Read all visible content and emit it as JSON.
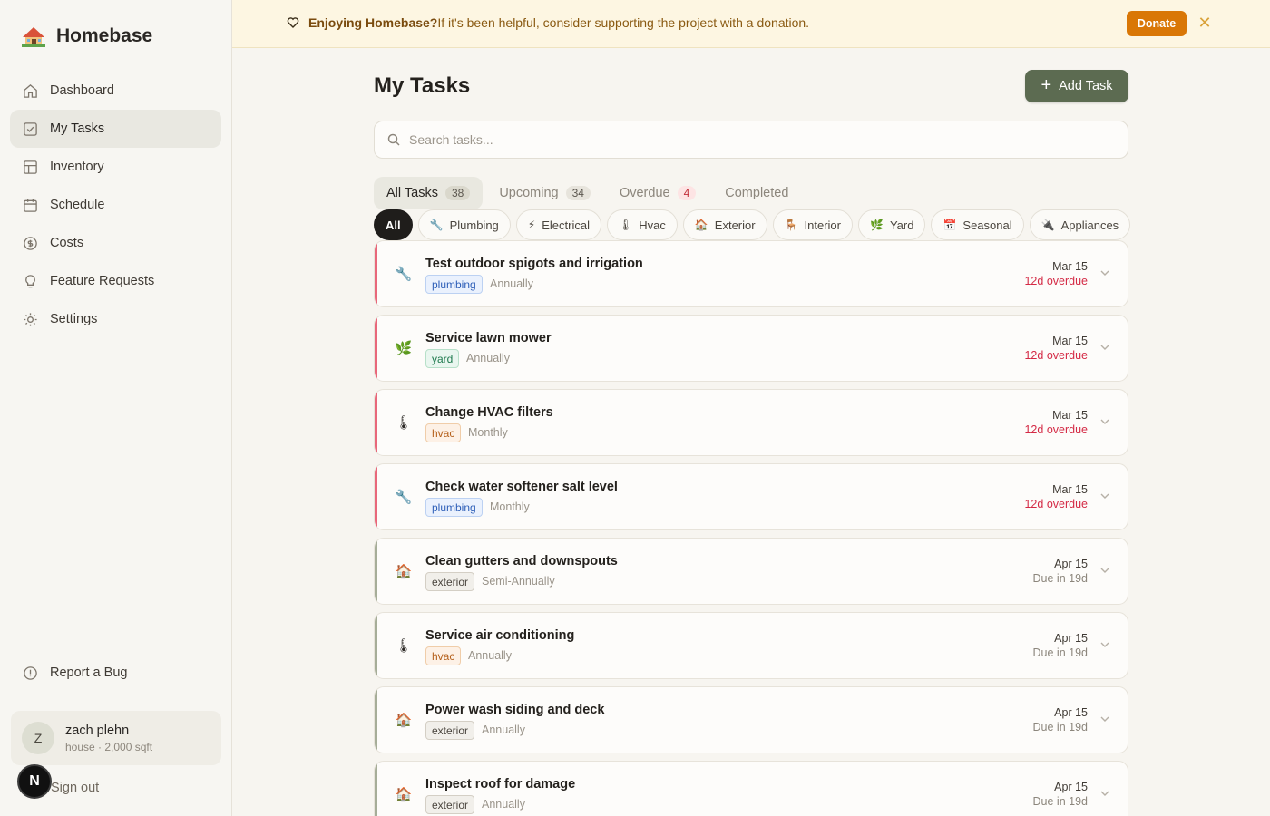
{
  "app": {
    "name": "Homebase",
    "logo_icon": "house-emoji-icon"
  },
  "sidebar": {
    "items": [
      {
        "label": "Dashboard",
        "icon": "home-icon"
      },
      {
        "label": "My Tasks",
        "icon": "checkbox-icon",
        "active": true
      },
      {
        "label": "Inventory",
        "icon": "layout-icon"
      },
      {
        "label": "Schedule",
        "icon": "calendar-icon"
      },
      {
        "label": "Costs",
        "icon": "coin-icon"
      },
      {
        "label": "Feature Requests",
        "icon": "lightbulb-icon"
      },
      {
        "label": "Settings",
        "icon": "sun-gear-icon"
      }
    ],
    "report_bug": "Report a Bug",
    "user": {
      "initial": "Z",
      "name": "zach plehn",
      "subtitle": "house · 2,000 sqft"
    },
    "sign_out": "Sign out",
    "next_badge": "N"
  },
  "banner": {
    "strong": "Enjoying Homebase?",
    "text": "If it's been helpful, consider supporting the project with a donation.",
    "donate_label": "Donate",
    "close_glyph": "✕"
  },
  "main": {
    "title": "My Tasks",
    "add_task_label": "Add Task",
    "search_placeholder": "Search tasks...",
    "tabs": [
      {
        "label": "All Tasks",
        "count": "38",
        "active": true
      },
      {
        "label": "Upcoming",
        "count": "34"
      },
      {
        "label": "Overdue",
        "count": "4",
        "alert": true
      },
      {
        "label": "Completed",
        "count": ""
      }
    ],
    "filters": [
      {
        "label": "All",
        "emoji": "",
        "active": true
      },
      {
        "label": "Plumbing",
        "emoji": "🔧"
      },
      {
        "label": "Electrical",
        "emoji": "⚡"
      },
      {
        "label": "Hvac",
        "emoji": "🌡"
      },
      {
        "label": "Exterior",
        "emoji": "🏠"
      },
      {
        "label": "Interior",
        "emoji": "🪑"
      },
      {
        "label": "Yard",
        "emoji": "🌿"
      },
      {
        "label": "Seasonal",
        "emoji": "📅"
      },
      {
        "label": "Appliances",
        "emoji": "🔌"
      }
    ],
    "tasks": [
      {
        "title": "Test outdoor spigots and irrigation",
        "tag": "plumbing",
        "frequency": "Annually",
        "date": "Mar 15",
        "status": "12d overdue",
        "overdue": true,
        "emoji": "🔧"
      },
      {
        "title": "Service lawn mower",
        "tag": "yard",
        "frequency": "Annually",
        "date": "Mar 15",
        "status": "12d overdue",
        "overdue": true,
        "emoji": "🌿"
      },
      {
        "title": "Change HVAC filters",
        "tag": "hvac",
        "frequency": "Monthly",
        "date": "Mar 15",
        "status": "12d overdue",
        "overdue": true,
        "emoji": "🌡"
      },
      {
        "title": "Check water softener salt level",
        "tag": "plumbing",
        "frequency": "Monthly",
        "date": "Mar 15",
        "status": "12d overdue",
        "overdue": true,
        "emoji": "🔧"
      },
      {
        "title": "Clean gutters and downspouts",
        "tag": "exterior",
        "frequency": "Semi-Annually",
        "date": "Apr 15",
        "status": "Due in 19d",
        "overdue": false,
        "emoji": "🏠"
      },
      {
        "title": "Service air conditioning",
        "tag": "hvac",
        "frequency": "Annually",
        "date": "Apr 15",
        "status": "Due in 19d",
        "overdue": false,
        "emoji": "🌡"
      },
      {
        "title": "Power wash siding and deck",
        "tag": "exterior",
        "frequency": "Annually",
        "date": "Apr 15",
        "status": "Due in 19d",
        "overdue": false,
        "emoji": "🏠"
      },
      {
        "title": "Inspect roof for damage",
        "tag": "exterior",
        "frequency": "Annually",
        "date": "Apr 15",
        "status": "Due in 19d",
        "overdue": false,
        "emoji": "🏠"
      }
    ]
  },
  "colors": {
    "overdue_accent": "#e8677a",
    "overdue_text": "#d42a45",
    "due_accent": "#a6ad98",
    "due_text": "#8c867c",
    "primary_button": "#5c6b51",
    "donate_button": "#d97706"
  }
}
